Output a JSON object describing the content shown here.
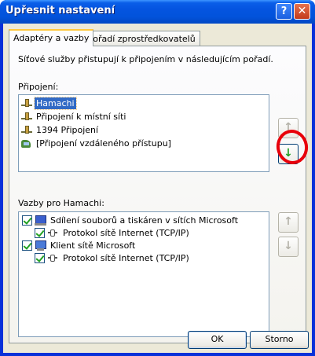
{
  "window": {
    "title": "Upřesnit nastavení",
    "help_glyph": "?",
    "close_glyph": "✕"
  },
  "tabs": [
    {
      "label": "Adaptéry a vazby",
      "active": true
    },
    {
      "label": "Pořadí zprostředkovatelů",
      "active": false
    }
  ],
  "description": "Síťové služby přistupují k připojením v následujícím pořadí.",
  "connections": {
    "label": "Připojení:",
    "items": [
      {
        "label": "Hamachi",
        "icon": "network-connection-icon",
        "selected": true
      },
      {
        "label": "Připojení k místní síti",
        "icon": "network-connection-icon",
        "selected": false
      },
      {
        "label": "1394 Připojení",
        "icon": "network-connection-icon",
        "selected": false
      },
      {
        "label": "[Připojení vzdáleného přístupu]",
        "icon": "dialup-connection-icon",
        "selected": false
      }
    ],
    "up_glyph": "↑",
    "down_glyph": "↓"
  },
  "bindings": {
    "label": "Vazby pro Hamachi:",
    "items": [
      {
        "label": "Sdílení souborů a tiskáren v sítích Microsoft",
        "checked": true,
        "level": 0,
        "icon": "file-printer-sharing-icon"
      },
      {
        "label": "Protokol sítě Internet (TCP/IP)",
        "checked": true,
        "level": 1,
        "icon": "protocol-icon"
      },
      {
        "label": "Klient sítě Microsoft",
        "checked": true,
        "level": 0,
        "icon": "network-client-icon"
      },
      {
        "label": "Protokol sítě Internet (TCP/IP)",
        "checked": true,
        "level": 1,
        "icon": "protocol-icon"
      }
    ],
    "up_glyph": "↑",
    "down_glyph": "↓"
  },
  "buttons": {
    "ok": "OK",
    "cancel": "Storno"
  },
  "colors": {
    "title_bar": "#0454e0",
    "selection": "#316ac5",
    "annotation_circle": "#e8000a",
    "move_down_arrow": "#1e9e1e"
  }
}
